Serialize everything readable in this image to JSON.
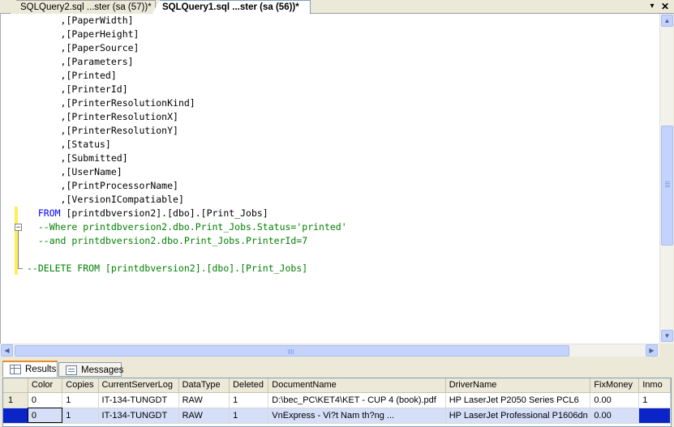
{
  "tabs": [
    {
      "label": "SQLQuery2.sql ...ster (sa (57))*",
      "active": false
    },
    {
      "label": "SQLQuery1.sql ...ster (sa (56))*",
      "active": true
    }
  ],
  "tab_controls": {
    "dropdown": "▾",
    "close": "✕"
  },
  "editor": {
    "lines": [
      {
        "indent": "      ",
        "segments": [
          {
            "t": ",[PaperWidth]",
            "c": "tx"
          }
        ]
      },
      {
        "indent": "      ",
        "segments": [
          {
            "t": ",[PaperHeight]",
            "c": "tx"
          }
        ]
      },
      {
        "indent": "      ",
        "segments": [
          {
            "t": ",[PaperSource]",
            "c": "tx"
          }
        ]
      },
      {
        "indent": "      ",
        "segments": [
          {
            "t": ",[Parameters]",
            "c": "tx"
          }
        ]
      },
      {
        "indent": "      ",
        "segments": [
          {
            "t": ",[Printed]",
            "c": "tx"
          }
        ]
      },
      {
        "indent": "      ",
        "segments": [
          {
            "t": ",[PrinterId]",
            "c": "tx"
          }
        ]
      },
      {
        "indent": "      ",
        "segments": [
          {
            "t": ",[PrinterResolutionKind]",
            "c": "tx"
          }
        ]
      },
      {
        "indent": "      ",
        "segments": [
          {
            "t": ",[PrinterResolutionX]",
            "c": "tx"
          }
        ]
      },
      {
        "indent": "      ",
        "segments": [
          {
            "t": ",[PrinterResolutionY]",
            "c": "tx"
          }
        ]
      },
      {
        "indent": "      ",
        "segments": [
          {
            "t": ",[Status]",
            "c": "tx"
          }
        ]
      },
      {
        "indent": "      ",
        "segments": [
          {
            "t": ",[Submitted]",
            "c": "tx"
          }
        ]
      },
      {
        "indent": "      ",
        "segments": [
          {
            "t": ",[UserName]",
            "c": "tx"
          }
        ]
      },
      {
        "indent": "      ",
        "segments": [
          {
            "t": ",[PrintProcessorName]",
            "c": "tx"
          }
        ]
      },
      {
        "indent": "      ",
        "segments": [
          {
            "t": ",[VersionICompatiable]",
            "c": "tx"
          }
        ]
      },
      {
        "indent": "  ",
        "segments": [
          {
            "t": "FROM",
            "c": "kw"
          },
          {
            "t": " [printdbversion2].[dbo].[Print_Jobs]",
            "c": "tx"
          }
        ]
      },
      {
        "indent": "  ",
        "segments": [
          {
            "t": "--Where printdbversion2.dbo.Print_Jobs.Status='printed'",
            "c": "cm"
          }
        ]
      },
      {
        "indent": "  ",
        "segments": [
          {
            "t": "--and printdbversion2.dbo.Print_Jobs.PrinterId=7",
            "c": "cm"
          }
        ]
      },
      {
        "indent": "",
        "segments": []
      },
      {
        "indent": "",
        "segments": [
          {
            "t": "--DELETE FROM [printdbversion2].[dbo].[Print_Jobs]",
            "c": "cm"
          }
        ]
      }
    ]
  },
  "results": {
    "tabs": [
      {
        "label": "Results",
        "active": true,
        "icon": "grid-icon"
      },
      {
        "label": "Messages",
        "active": false,
        "icon": "messages-icon"
      }
    ],
    "columns": [
      "",
      "Color",
      "Copies",
      "CurrentServerLog",
      "DataType",
      "Deleted",
      "DocumentName",
      "DriverName",
      "FixMoney",
      "Inmo"
    ],
    "rows": [
      [
        "1",
        "0",
        "1",
        "IT-134-TUNGDT",
        "RAW",
        "1",
        "D:\\bec_PC\\KET4\\KET - CUP 4 (book).pdf",
        "HP LaserJet P2050 Series PCL6",
        "0.00",
        "1"
      ],
      [
        "",
        "0",
        "1",
        "IT-134-TUNGDT",
        "RAW",
        "1",
        "VnExpress - Vi?t Nam th?ng ...",
        "HP LaserJet Professional P1606dn",
        "0.00",
        ""
      ]
    ],
    "selected_row": 1
  },
  "colors": {
    "keyword": "#0000ff",
    "comment": "#008000",
    "selection": "#0a24c8",
    "change_marker": "#ffee55"
  }
}
